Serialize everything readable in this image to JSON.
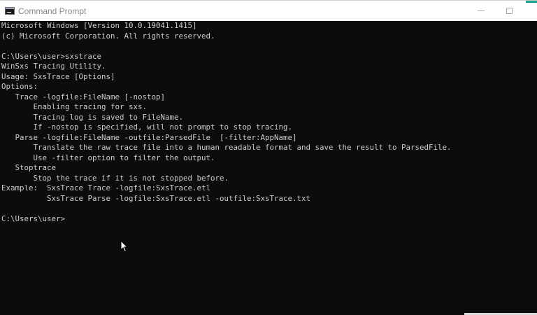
{
  "window": {
    "title": "Command Prompt"
  },
  "terminal": {
    "lines": [
      "Microsoft Windows [Version 10.0.19041.1415]",
      "(c) Microsoft Corporation. All rights reserved.",
      "",
      "C:\\Users\\user>sxstrace",
      "WinSxs Tracing Utility.",
      "Usage: SxsTrace [Options]",
      "Options:",
      "   Trace -logfile:FileName [-nostop]",
      "       Enabling tracing for sxs.",
      "       Tracing log is saved to FileName.",
      "       If -nostop is specified, will not prompt to stop tracing.",
      "   Parse -logfile:FileName -outfile:ParsedFile  [-filter:AppName]",
      "       Translate the raw trace file into a human readable format and save the result to ParsedFile.",
      "       Use -filter option to filter the output.",
      "   Stoptrace",
      "       Stop the trace if it is not stopped before.",
      "Example:  SxsTrace Trace -logfile:SxsTrace.etl",
      "          SxsTrace Parse -logfile:SxsTrace.etl -outfile:SxsTrace.txt",
      "",
      "C:\\Users\\user>"
    ]
  },
  "icons": {
    "app": "cmd-icon",
    "minimize": "minimize-icon",
    "maximize": "maximize-icon",
    "pointer": "mouse-pointer-icon"
  },
  "colors": {
    "terminal_bg": "#0c0c0c",
    "terminal_fg": "#cccccc",
    "titlebar_bg": "#ffffff",
    "title_text": "#8a8a8a",
    "accent": "#1fa58f"
  }
}
